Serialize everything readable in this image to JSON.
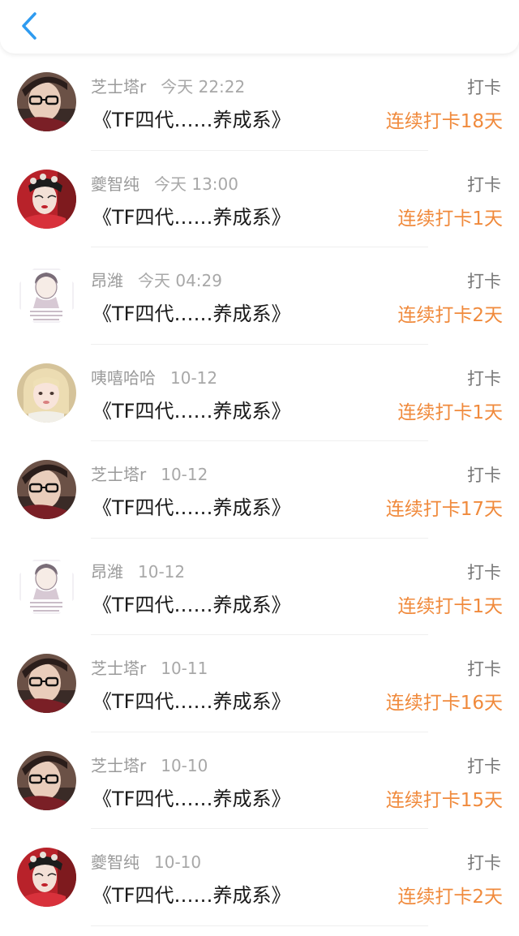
{
  "header": {
    "back_icon": "chevron-left-icon"
  },
  "colors": {
    "accent": "#2e9bf0",
    "streak": "#f08a3c"
  },
  "entries": [
    {
      "user": "芝士塔r",
      "time": "今天 22:22",
      "title": "《TF四代……养成系》",
      "action": "打卡",
      "streak": "连续打卡18天",
      "avatar": "avatar-a"
    },
    {
      "user": "夔智纯",
      "time": "今天 13:00",
      "title": "《TF四代……养成系》",
      "action": "打卡",
      "streak": "连续打卡1天",
      "avatar": "avatar-b"
    },
    {
      "user": "昂潍",
      "time": "今天 04:29",
      "title": "《TF四代……养成系》",
      "action": "打卡",
      "streak": "连续打卡2天",
      "avatar": "avatar-c"
    },
    {
      "user": "咦嘻哈哈",
      "time": "10-12",
      "title": "《TF四代……养成系》",
      "action": "打卡",
      "streak": "连续打卡1天",
      "avatar": "avatar-d"
    },
    {
      "user": "芝士塔r",
      "time": "10-12",
      "title": "《TF四代……养成系》",
      "action": "打卡",
      "streak": "连续打卡17天",
      "avatar": "avatar-a"
    },
    {
      "user": "昂潍",
      "time": "10-12",
      "title": "《TF四代……养成系》",
      "action": "打卡",
      "streak": "连续打卡1天",
      "avatar": "avatar-c"
    },
    {
      "user": "芝士塔r",
      "time": "10-11",
      "title": "《TF四代……养成系》",
      "action": "打卡",
      "streak": "连续打卡16天",
      "avatar": "avatar-a"
    },
    {
      "user": "芝士塔r",
      "time": "10-10",
      "title": "《TF四代……养成系》",
      "action": "打卡",
      "streak": "连续打卡15天",
      "avatar": "avatar-a"
    },
    {
      "user": "夔智纯",
      "time": "10-10",
      "title": "《TF四代……养成系》",
      "action": "打卡",
      "streak": "连续打卡2天",
      "avatar": "avatar-b"
    }
  ]
}
